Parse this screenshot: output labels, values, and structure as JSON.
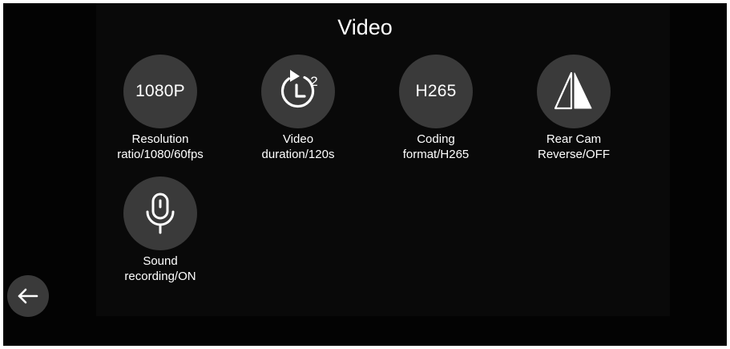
{
  "header": {
    "title": "Video"
  },
  "settings": [
    {
      "circle_text": "1080P",
      "caption_line1": "Resolution",
      "caption_line2": "ratio/1080/60fps",
      "icon": "resolution-text"
    },
    {
      "circle_text": "2",
      "caption_line1": "Video",
      "caption_line2": "duration/120s",
      "icon": "loop-timer-icon"
    },
    {
      "circle_text": "H265",
      "caption_line1": "Coding",
      "caption_line2": "format/H265",
      "icon": "coding-text"
    },
    {
      "caption_line1": "Rear Cam",
      "caption_line2": "Reverse/OFF",
      "icon": "mirror-flip-icon"
    },
    {
      "caption_line1": "Sound",
      "caption_line2": "recording/ON",
      "icon": "microphone-icon"
    }
  ],
  "nav": {
    "back_icon": "arrow-left-icon"
  },
  "colors": {
    "background": "#030303",
    "tile_circle": "#3a3a3a",
    "text": "#ffffff"
  }
}
